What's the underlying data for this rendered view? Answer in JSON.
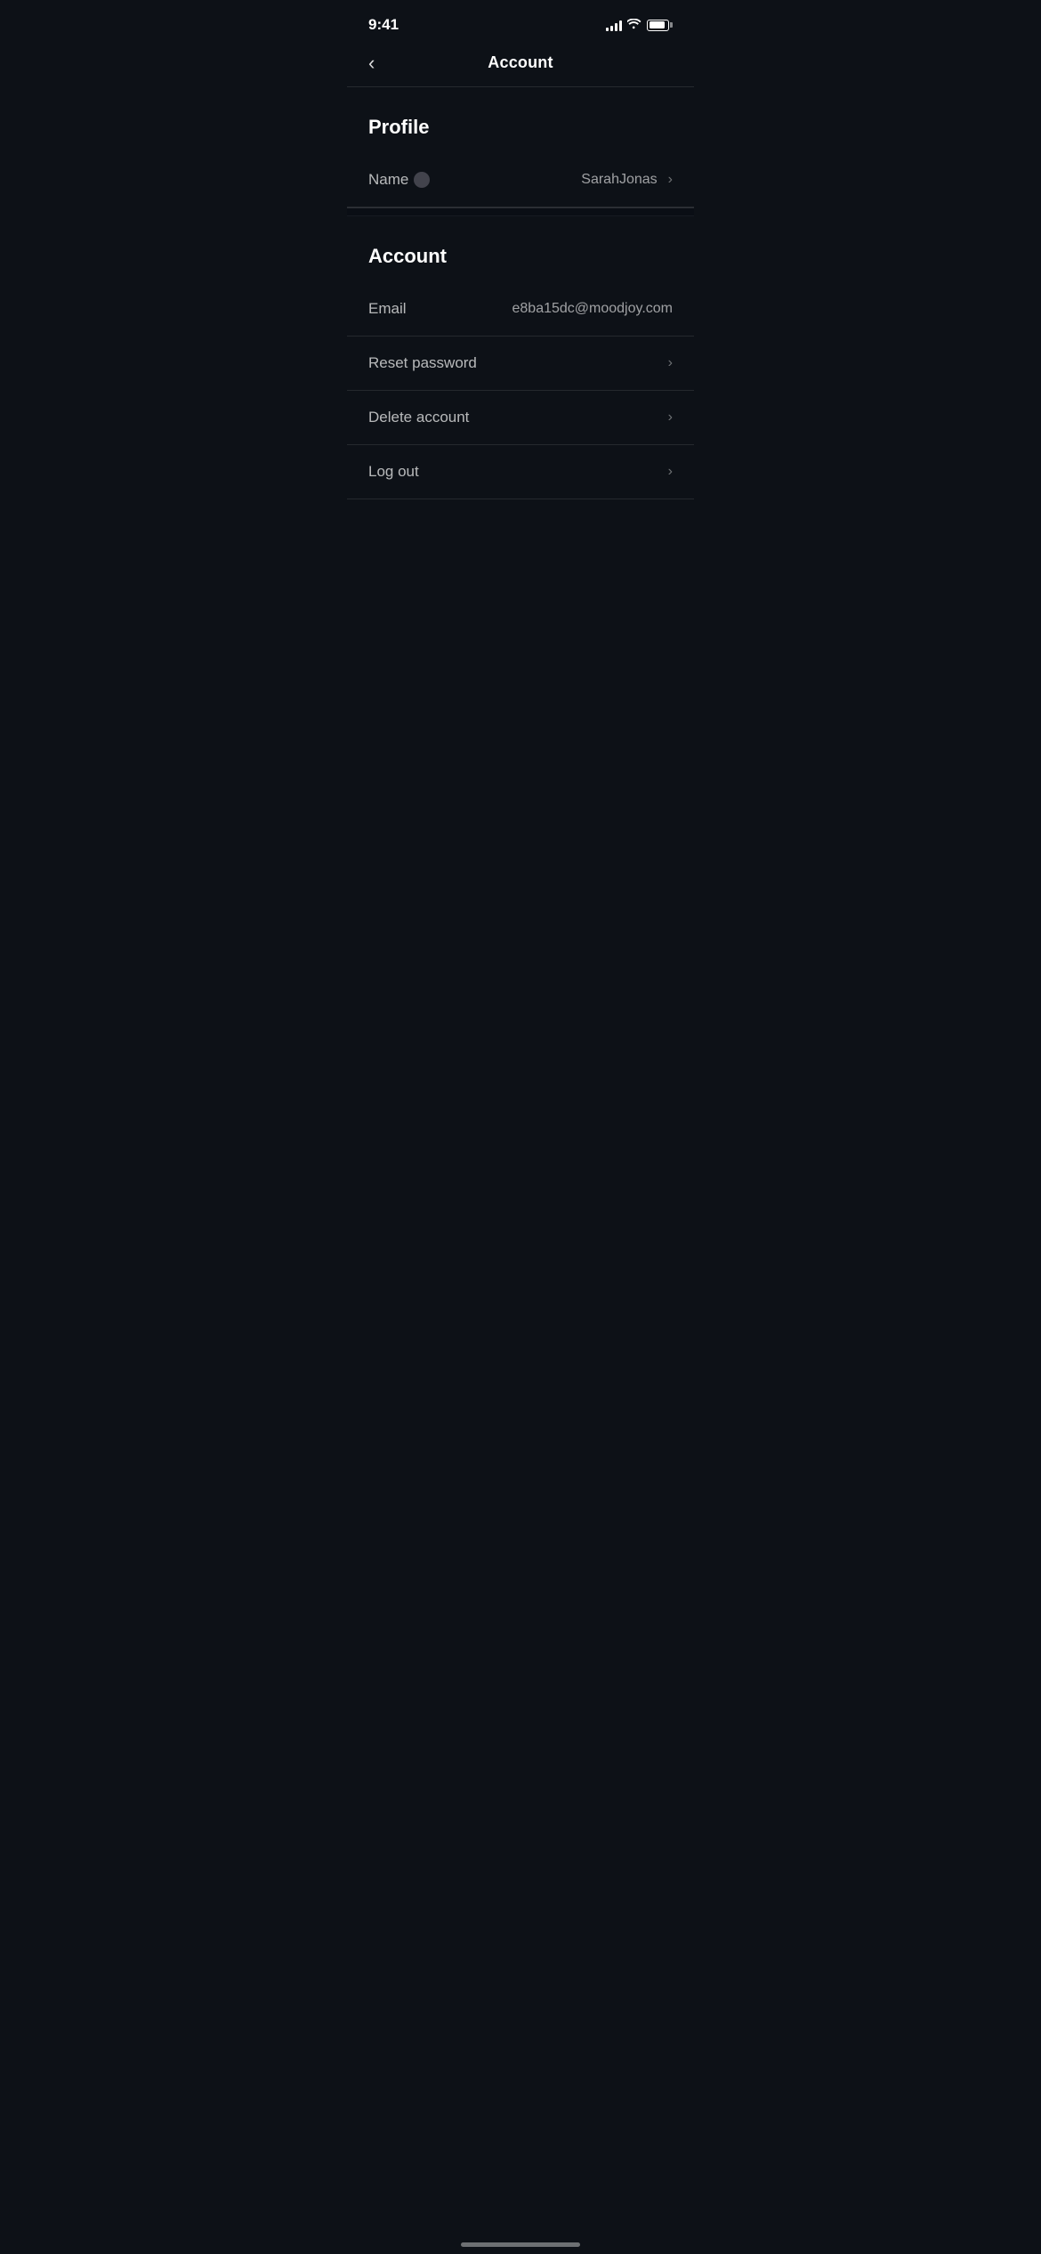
{
  "statusBar": {
    "time": "9:41",
    "signalBars": [
      4,
      6,
      9,
      11,
      14
    ],
    "batteryPercent": 85
  },
  "nav": {
    "backLabel": "‹",
    "title": "Account"
  },
  "profileSection": {
    "header": "Profile",
    "items": [
      {
        "label": "Name",
        "value": "SarahJonas",
        "hasChevron": true,
        "hasDot": true
      }
    ]
  },
  "accountSection": {
    "header": "Account",
    "items": [
      {
        "label": "Email",
        "value": "e8ba15dc@moodjoy.com",
        "hasChevron": false
      },
      {
        "label": "Reset password",
        "value": "",
        "hasChevron": true
      },
      {
        "label": "Delete account",
        "value": "",
        "hasChevron": true
      },
      {
        "label": "Log out",
        "value": "",
        "hasChevron": true
      }
    ]
  }
}
